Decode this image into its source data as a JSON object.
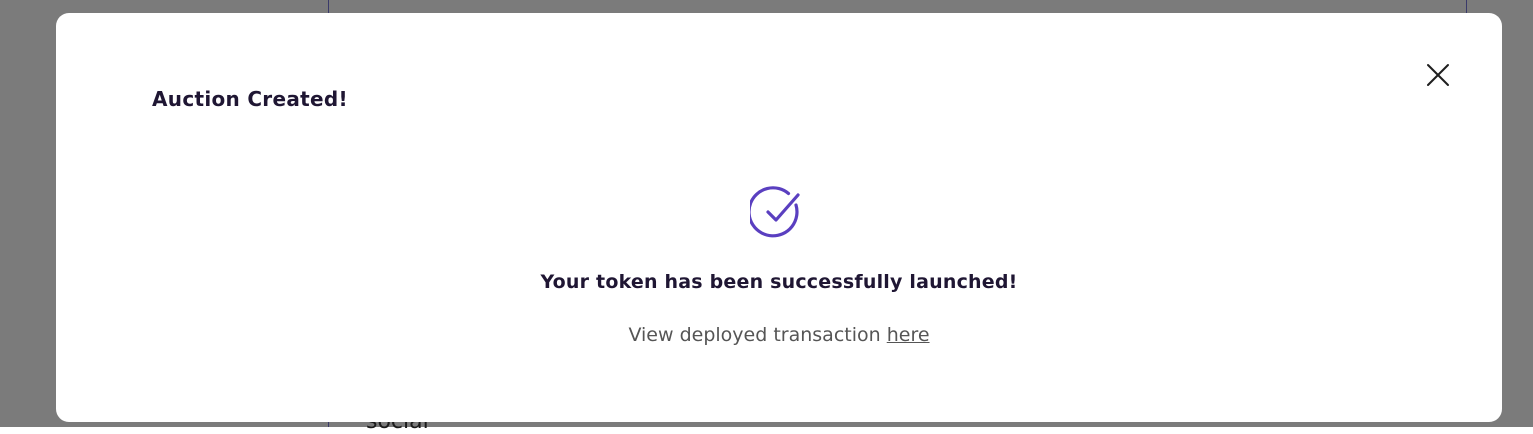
{
  "background": {
    "partial_text": "social"
  },
  "modal": {
    "title": "Auction Created!",
    "close_icon": "close-icon",
    "success_icon": "check-circle-icon",
    "success_message": "Your token has been successfully launched!",
    "transaction_text": "View deployed transaction",
    "transaction_link_label": "here",
    "accent_color": "#5a3fc0"
  }
}
